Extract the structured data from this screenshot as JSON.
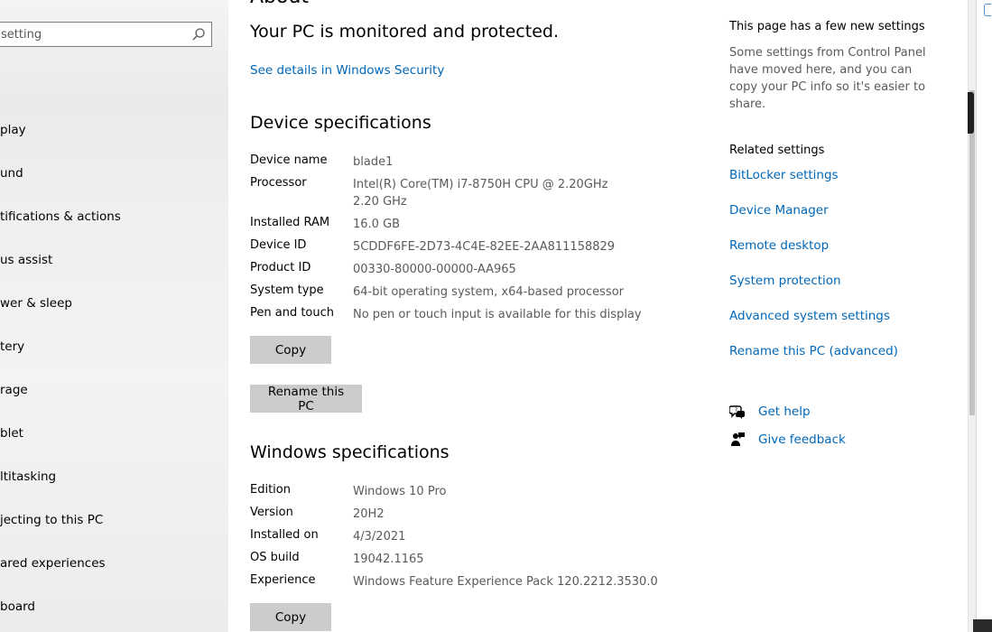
{
  "search": {
    "placeholder": "setting"
  },
  "sidebar": {
    "items": [
      {
        "label": "play"
      },
      {
        "label": "und"
      },
      {
        "label": "tifications & actions"
      },
      {
        "label": "us assist"
      },
      {
        "label": "wer & sleep"
      },
      {
        "label": "tery"
      },
      {
        "label": "rage"
      },
      {
        "label": "blet"
      },
      {
        "label": "ltitasking"
      },
      {
        "label": "jecting to this PC"
      },
      {
        "label": "ared experiences"
      },
      {
        "label": "board"
      }
    ]
  },
  "main": {
    "page_title": "About",
    "status_heading": "Your PC is monitored and protected.",
    "security_link": "See details in Windows Security",
    "device_specs": {
      "title": "Device specifications",
      "rows": [
        {
          "key": "Device name",
          "value": "blade1"
        },
        {
          "key": "Processor",
          "value": "Intel(R) Core(TM) i7-8750H CPU @ 2.20GHz   2.20 GHz"
        },
        {
          "key": "Installed RAM",
          "value": "16.0 GB"
        },
        {
          "key": "Device ID",
          "value": "5CDDF6FE-2D73-4C4E-82EE-2AA811158829"
        },
        {
          "key": "Product ID",
          "value": "00330-80000-00000-AA965"
        },
        {
          "key": "System type",
          "value": "64-bit operating system, x64-based processor"
        },
        {
          "key": "Pen and touch",
          "value": "No pen or touch input is available for this display"
        }
      ],
      "copy_label": "Copy",
      "rename_label": "Rename this PC"
    },
    "windows_specs": {
      "title": "Windows specifications",
      "rows": [
        {
          "key": "Edition",
          "value": "Windows 10 Pro"
        },
        {
          "key": "Version",
          "value": "20H2"
        },
        {
          "key": "Installed on",
          "value": "4/3/2021"
        },
        {
          "key": "OS build",
          "value": "19042.1165"
        },
        {
          "key": "Experience",
          "value": "Windows Feature Experience Pack 120.2212.3530.0"
        }
      ],
      "copy_label": "Copy"
    }
  },
  "right": {
    "new_settings_title": "This page has a few new settings",
    "new_settings_text": "Some settings from Control Panel have moved here, and you can copy your PC info so it's easier to share.",
    "related_title": "Related settings",
    "links": [
      "BitLocker settings",
      "Device Manager",
      "Remote desktop",
      "System protection",
      "Advanced system settings",
      "Rename this PC (advanced)"
    ],
    "get_help": "Get help",
    "give_feedback": "Give feedback"
  },
  "colors": {
    "accent": "#0067b8",
    "button": "#cccccc",
    "secondary_text": "#5a5a5a"
  }
}
